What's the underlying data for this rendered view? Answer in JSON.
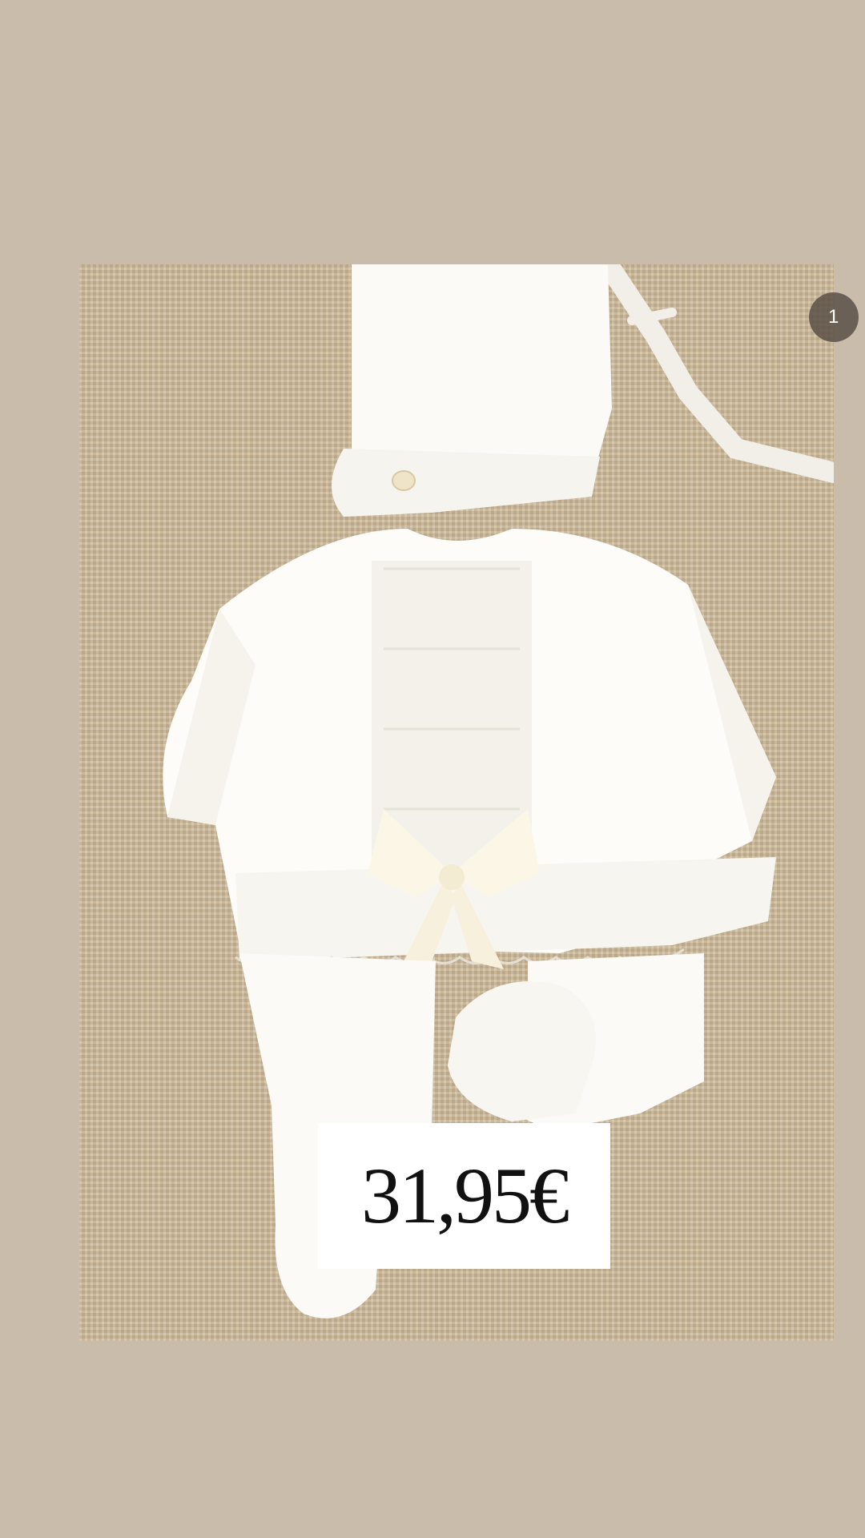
{
  "story": {
    "background_color": "#c9bcaa",
    "photo": {
      "subject_icon": "baby-knit-outfit-image"
    },
    "price_label": "31,95€",
    "badge_text": "1"
  }
}
